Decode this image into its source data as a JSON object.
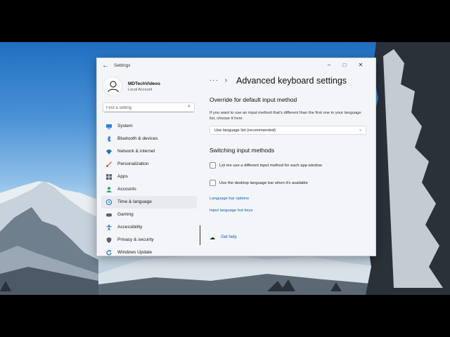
{
  "window": {
    "back_glyph": "←",
    "title": "Settings",
    "minimize": "–",
    "maximize": "□",
    "close": "✕"
  },
  "profile": {
    "name": "MDTechVideos",
    "account": "Local Account"
  },
  "search": {
    "placeholder": "Find a setting",
    "icon": "search-icon"
  },
  "sidebar": {
    "items": [
      {
        "label": "System",
        "icon": "monitor-icon",
        "color": "#2b7fd6"
      },
      {
        "label": "Bluetooth & devices",
        "icon": "bluetooth-icon",
        "color": "#1c6fc9"
      },
      {
        "label": "Network & internet",
        "icon": "wifi-icon",
        "color": "#1c6fc9"
      },
      {
        "label": "Personalization",
        "icon": "brush-icon",
        "color": "#e0703a"
      },
      {
        "label": "Apps",
        "icon": "apps-icon",
        "color": "#5a6270"
      },
      {
        "label": "Accounts",
        "icon": "person-icon",
        "color": "#2fa36b"
      },
      {
        "label": "Time & language",
        "icon": "globe-clock-icon",
        "color": "#1c6fc9",
        "active": true
      },
      {
        "label": "Gaming",
        "icon": "gamepad-icon",
        "color": "#5a6270"
      },
      {
        "label": "Accessibility",
        "icon": "accessibility-icon",
        "color": "#1c6fc9"
      },
      {
        "label": "Privacy & security",
        "icon": "shield-icon",
        "color": "#5a6270"
      },
      {
        "label": "Windows Update",
        "icon": "update-icon",
        "color": "#1c6fc9"
      }
    ]
  },
  "main": {
    "breadcrumb_dots": "···",
    "breadcrumb_chevron": "›",
    "title": "Advanced keyboard settings",
    "override": {
      "heading": "Override for default input method",
      "description": "If you want to use an input method that's different than the first one in your language list, choose it here",
      "dropdown_value": "Use language list (recommended)"
    },
    "switching": {
      "heading": "Switching input methods",
      "checkbox1": "Let me use a different input method for each app window",
      "checkbox2": "Use the desktop language bar when it's available"
    },
    "links": {
      "language_bar": "Language bar options",
      "hot_keys": "Input language hot keys"
    },
    "help": "Get help"
  }
}
